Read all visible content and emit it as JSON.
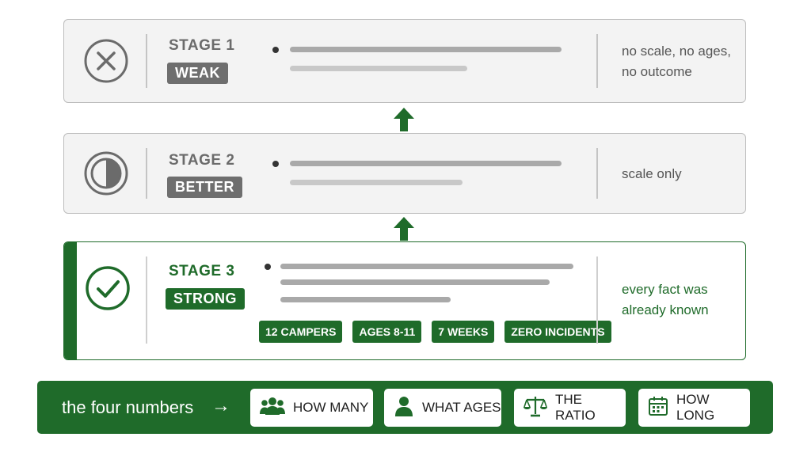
{
  "stages": [
    {
      "label": "STAGE 1",
      "rating": "WEAK",
      "icon": "x-circle-icon",
      "note_lines": [
        "no scale, no ages,",
        "no outcome"
      ]
    },
    {
      "label": "STAGE 2",
      "rating": "BETTER",
      "icon": "half-circle-icon",
      "note_lines": [
        "scale only"
      ]
    },
    {
      "label": "STAGE 3",
      "rating": "STRONG",
      "icon": "check-circle-icon",
      "note_lines": [
        "every fact was",
        "already known"
      ],
      "facts": [
        "12 CAMPERS",
        "AGES 8-11",
        "7 WEEKS",
        "ZERO INCIDENTS"
      ]
    }
  ],
  "summary": {
    "label": "the four numbers",
    "arrow": "→",
    "keys": [
      {
        "label": "HOW MANY",
        "icon": "group-icon"
      },
      {
        "label": "WHAT AGES",
        "icon": "person-icon"
      },
      {
        "label": "THE RATIO",
        "icon": "scales-icon"
      },
      {
        "label": "HOW LONG",
        "icon": "calendar-icon"
      }
    ]
  },
  "colors": {
    "accent_green": "#1f6b2a",
    "muted_gray": "#6e6e6e",
    "card_gray": "#f3f3f3"
  }
}
